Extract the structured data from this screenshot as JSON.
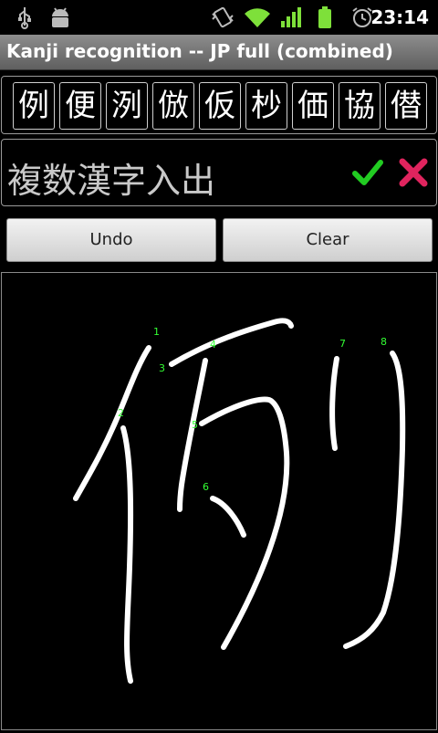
{
  "status_bar": {
    "time": "23:14",
    "icons": [
      "usb-icon",
      "android-debug-icon",
      "vibrate-icon",
      "wifi-icon",
      "signal-icon",
      "battery-icon",
      "alarm-icon"
    ]
  },
  "title": "Kanji recognition -- JP full (combined)",
  "candidates": [
    "例",
    "便",
    "洌",
    "倣",
    "仮",
    "杪",
    "価",
    "協",
    "僣"
  ],
  "input": {
    "text": "複数漢字入出",
    "accept_icon": "check-icon",
    "cancel_icon": "x-icon",
    "accent_ok": "#22cc22",
    "accent_cancel": "#e0245e"
  },
  "buttons": {
    "undo": "Undo",
    "clear": "Clear"
  },
  "stroke_numbers": [
    "1",
    "2",
    "3",
    "4",
    "5",
    "6",
    "7",
    "8"
  ]
}
